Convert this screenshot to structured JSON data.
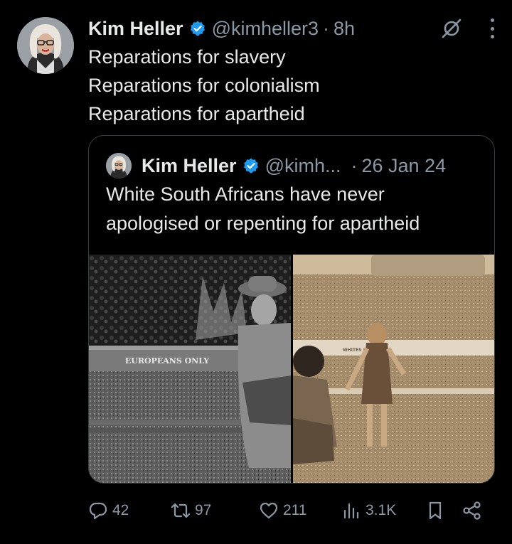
{
  "tweet": {
    "author_name": "Kim Heller",
    "author_handle": "@kimheller3",
    "separator": "·",
    "time": "8h",
    "lines": [
      "Reparations for slavery",
      "Reparations for colonialism",
      "Reparations for apartheid"
    ]
  },
  "quote": {
    "author_name": "Kim Heller",
    "author_handle": "@kimh...",
    "separator": "·",
    "date": "26 Jan 24",
    "lines": [
      "White South Africans have never",
      "apologised or repenting for apartheid"
    ],
    "media": {
      "left_sign": "EUROPEANS ONLY",
      "right_sign": "WHITES ONLY"
    }
  },
  "actions": {
    "replies": "42",
    "reposts": "97",
    "likes": "211",
    "views": "3.1K"
  },
  "colors": {
    "background": "#000000",
    "text": "#e7e9ea",
    "muted": "#8b98a5",
    "verified": "#1d9bf0",
    "border": "#3a3f44"
  },
  "icons": [
    "verified-badge-icon",
    "grok-icon",
    "more-icon",
    "reply-icon",
    "repost-icon",
    "like-icon",
    "views-icon",
    "bookmark-icon",
    "share-icon"
  ]
}
